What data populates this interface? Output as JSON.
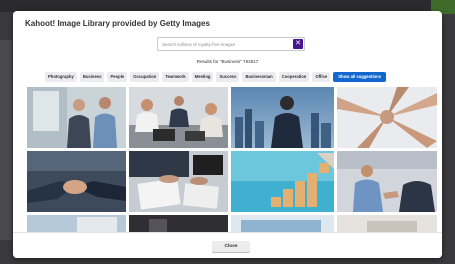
{
  "modal": {
    "title": "Kahoot! Image Library provided by Getty Images",
    "search": {
      "placeholder": "Search millions of royalty-free images",
      "value": ""
    },
    "clear_glyph": "✕",
    "results_text": "Results for \"Business\" 763517",
    "chips": [
      "Photography",
      "Business",
      "People",
      "Occupation",
      "Teamwork",
      "Meeting",
      "Success",
      "Businessman",
      "Cooperation",
      "Office"
    ],
    "show_all_label": "Show all suggestions",
    "close_label": "Close",
    "accent_color": "#46178f",
    "chip_primary_color": "#1368ce"
  },
  "images": [
    {
      "name": "image-two-businessmen-office"
    },
    {
      "name": "image-team-meeting-laptops"
    },
    {
      "name": "image-businessman-city-skyline"
    },
    {
      "name": "image-hands-stacked-teamwork"
    },
    {
      "name": "image-handshake-closeup"
    },
    {
      "name": "image-desk-paperwork-laptop"
    },
    {
      "name": "image-growth-blocks-steps"
    },
    {
      "name": "image-businessmen-handshake-office"
    },
    {
      "name": "image-partial-row-1"
    },
    {
      "name": "image-partial-row-2"
    },
    {
      "name": "image-partial-row-3"
    },
    {
      "name": "image-partial-row-4"
    }
  ]
}
